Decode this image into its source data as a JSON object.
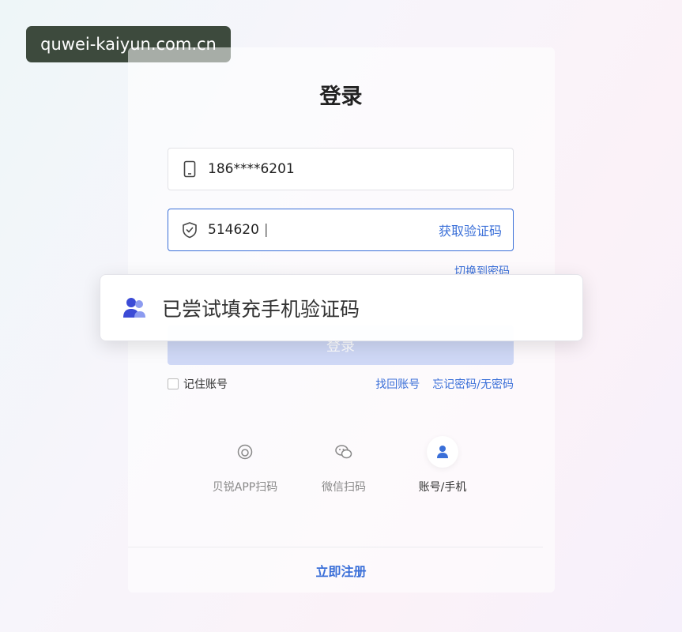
{
  "watermark": "quwei-kaiyun.com.cn",
  "login": {
    "title": "登录",
    "phone_value": "186****6201",
    "code_value": "514620",
    "cursor": "|",
    "get_code": "获取验证码",
    "switch_password": "切换到密码",
    "login_button": "登录",
    "remember": "记住账号",
    "find_account": "找回账号",
    "forgot_password": "忘记密码/无密码"
  },
  "methods": [
    {
      "label": "贝锐APP扫码",
      "icon": "app-scan-icon"
    },
    {
      "label": "微信扫码",
      "icon": "wechat-icon"
    },
    {
      "label": "账号/手机",
      "icon": "user-icon",
      "active": true
    }
  ],
  "register": "立即注册",
  "toast": {
    "message": "已尝试填充手机验证码",
    "icon": "users-icon"
  },
  "colors": {
    "accent": "#3a6fd8",
    "button_disabled": "#cfd8f6"
  }
}
